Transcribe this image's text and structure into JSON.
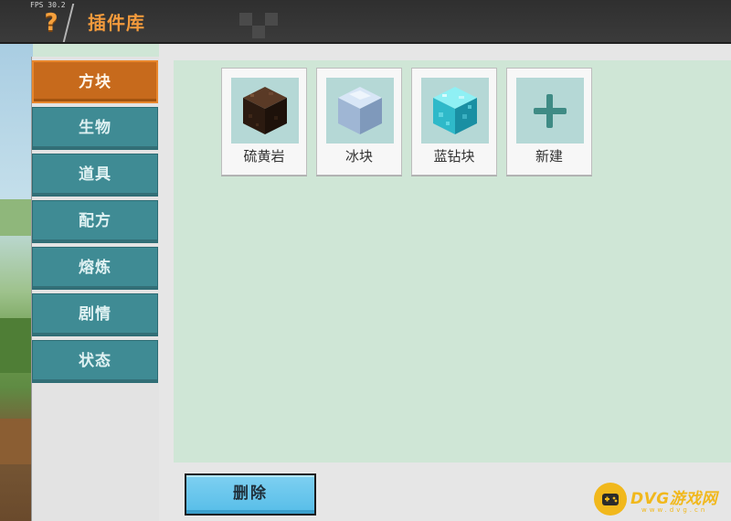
{
  "header": {
    "fps": "FPS 30.2",
    "help_icon": "question-mark-icon",
    "title": "插件库"
  },
  "sidebar": {
    "items": [
      {
        "label": "方块",
        "active": true
      },
      {
        "label": "生物",
        "active": false
      },
      {
        "label": "道具",
        "active": false
      },
      {
        "label": "配方",
        "active": false
      },
      {
        "label": "熔炼",
        "active": false
      },
      {
        "label": "剧情",
        "active": false
      },
      {
        "label": "状态",
        "active": false
      }
    ]
  },
  "cards": [
    {
      "label": "硫黄岩",
      "icon": "sulfur-rock-block-icon"
    },
    {
      "label": "冰块",
      "icon": "ice-block-icon"
    },
    {
      "label": "蓝钻块",
      "icon": "blue-diamond-block-icon"
    },
    {
      "label": "新建",
      "icon": "plus-icon"
    }
  ],
  "actions": {
    "delete_label": "删除"
  },
  "watermark": {
    "text": "DVG游戏网",
    "sub": "www.dvg.cn"
  },
  "colors": {
    "accent_orange": "#f39a3c",
    "nav_teal": "#3f8b94",
    "nav_active": "#c76a1c",
    "panel_green": "#cfe6d6",
    "button_blue": "#56bde8"
  }
}
